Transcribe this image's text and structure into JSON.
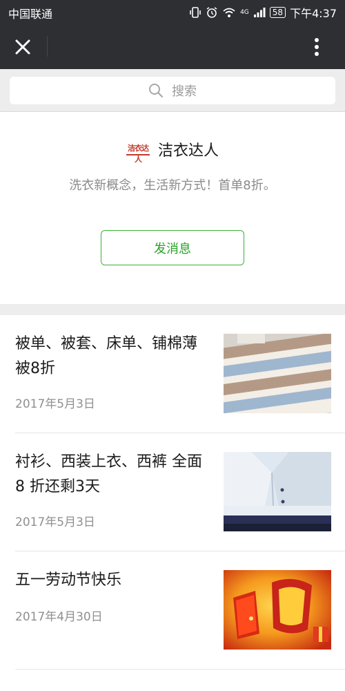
{
  "status_bar": {
    "carrier": "中国联通",
    "network": "4G",
    "battery": "58",
    "time": "下午4:37"
  },
  "nav": {
    "close_icon": "close-icon",
    "more_icon": "more-vertical-icon"
  },
  "search": {
    "placeholder": "搜索",
    "icon": "search-icon"
  },
  "profile": {
    "logo_text": "洁衣达人",
    "name": "洁衣达人",
    "description": "洗衣新概念，生活新方式！首单8折。",
    "message_button": "发消息"
  },
  "articles": [
    {
      "title": "被单、被套、床单、铺棉薄被8折",
      "date": "2017年5月3日",
      "thumb": "striped-bedsheets"
    },
    {
      "title": "衬衫、西装上衣、西裤 全面 8 折还剩3天",
      "date": "2017年5月3日",
      "thumb": "folded-shirts"
    },
    {
      "title": "五一劳动节快乐",
      "date": "2017年4月30日",
      "thumb": "may-day-banner"
    }
  ],
  "colors": {
    "header_bg": "#2e2f33",
    "accent_green": "#2aa12a",
    "page_bg": "#ededed"
  }
}
